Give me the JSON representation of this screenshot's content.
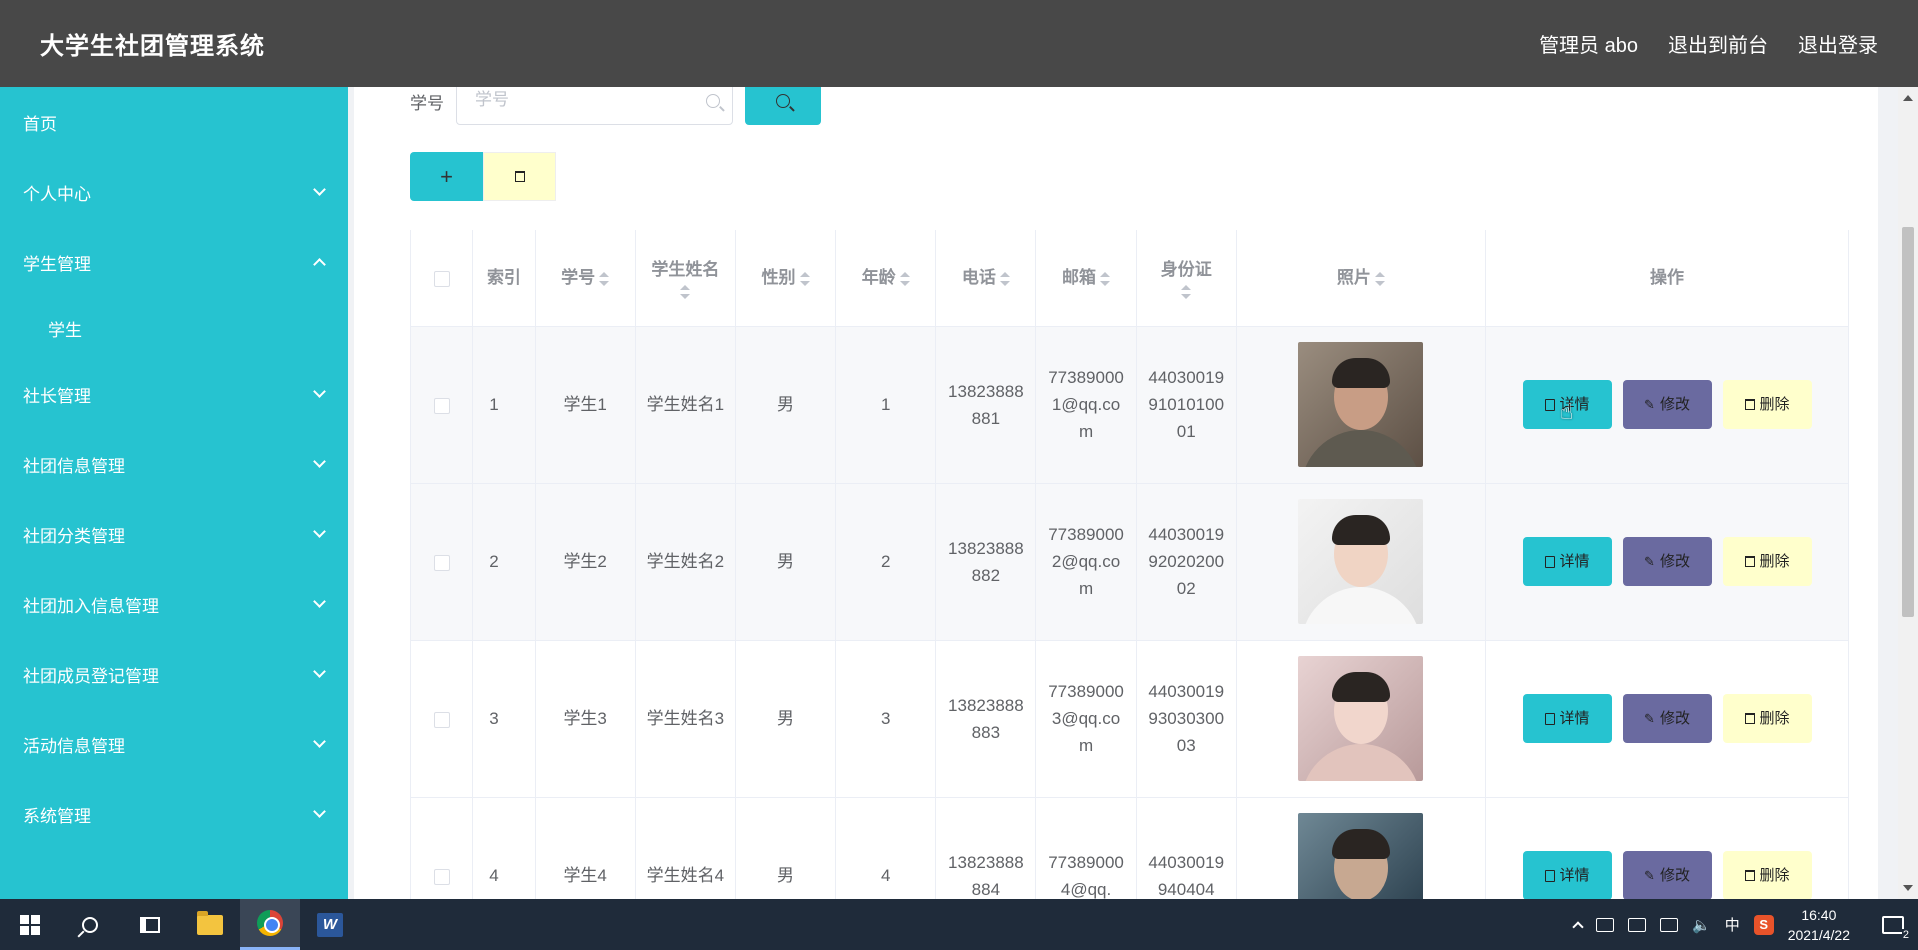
{
  "header": {
    "title": "大学生社团管理系统",
    "nav": [
      "管理员 abo",
      "退出到前台",
      "退出登录"
    ]
  },
  "sidebar": {
    "items": [
      {
        "label": "首页",
        "expandable": false
      },
      {
        "label": "个人中心",
        "expandable": true,
        "expanded": false
      },
      {
        "label": "学生管理",
        "expandable": true,
        "expanded": true,
        "children": [
          "学生"
        ]
      },
      {
        "label": "社长管理",
        "expandable": true,
        "expanded": false
      },
      {
        "label": "社团信息管理",
        "expandable": true,
        "expanded": false
      },
      {
        "label": "社团分类管理",
        "expandable": true,
        "expanded": false
      },
      {
        "label": "社团加入信息管理",
        "expandable": true,
        "expanded": false
      },
      {
        "label": "社团成员登记管理",
        "expandable": true,
        "expanded": false
      },
      {
        "label": "活动信息管理",
        "expandable": true,
        "expanded": false
      },
      {
        "label": "系统管理",
        "expandable": true,
        "expanded": false
      }
    ]
  },
  "search": {
    "label": "学号",
    "placeholder": "学号",
    "value": ""
  },
  "table": {
    "columns": [
      "索引",
      "学号",
      "学生姓名",
      "性别",
      "年龄",
      "电话",
      "邮箱",
      "身份证",
      "照片",
      "操作"
    ],
    "rows": [
      {
        "index": "1",
        "student_no": "学生1",
        "name": "学生姓名1",
        "gender": "男",
        "age": "1",
        "phone": "13823888881",
        "email": "773890001@qq.com",
        "id_card": "440300199101010001",
        "photo": "portrait-1"
      },
      {
        "index": "2",
        "student_no": "学生2",
        "name": "学生姓名2",
        "gender": "男",
        "age": "2",
        "phone": "13823888882",
        "email": "773890002@qq.com",
        "id_card": "440300199202020002",
        "photo": "portrait-2"
      },
      {
        "index": "3",
        "student_no": "学生3",
        "name": "学生姓名3",
        "gender": "男",
        "age": "3",
        "phone": "13823888883",
        "email": "773890003@qq.com",
        "id_card": "440300199303030003",
        "photo": "portrait-3"
      },
      {
        "index": "4",
        "student_no": "学生4",
        "name": "学生姓名4",
        "gender": "男",
        "age": "4",
        "phone": "13823888884",
        "email": "773890004@qq.",
        "id_card": "44030019940404",
        "photo": "portrait-4"
      }
    ],
    "actions": {
      "detail": "详情",
      "edit": "修改",
      "delete": "删除"
    }
  },
  "taskbar": {
    "ime": "中",
    "time": "16:40",
    "date": "2021/4/22",
    "notifications": "2"
  },
  "colors": {
    "header_bg": "#484848",
    "sidebar_bg": "#26c3d0",
    "accent": "#26c3d0",
    "edit_btn": "#6a6aa0",
    "delete_btn": "#ffffcc"
  }
}
